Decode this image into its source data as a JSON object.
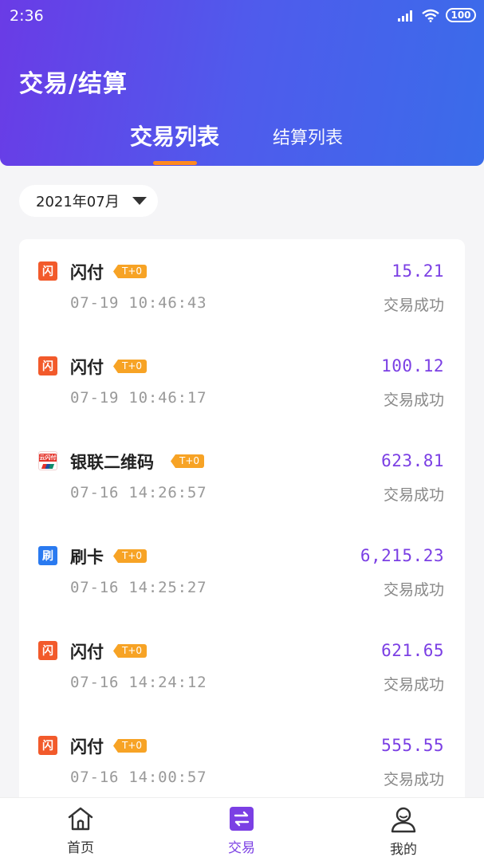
{
  "status_bar": {
    "time": "2:36",
    "battery": "100"
  },
  "header": {
    "title": "交易/结算"
  },
  "tabs": [
    {
      "label": "交易列表",
      "active": true
    },
    {
      "label": "结算列表",
      "active": false
    }
  ],
  "filter": {
    "month": "2021年07月"
  },
  "transactions": [
    {
      "icon": "flash-icon",
      "icon_char": "闪",
      "name": "闪付",
      "badge": "T+0",
      "amount": "15.21",
      "time": "07-19 10:46:43",
      "status": "交易成功"
    },
    {
      "icon": "flash-icon",
      "icon_char": "闪",
      "name": "闪付",
      "badge": "T+0",
      "amount": "100.12",
      "time": "07-19 10:46:17",
      "status": "交易成功"
    },
    {
      "icon": "unionpay-icon",
      "icon_char": "云闪付",
      "name": "银联二维码",
      "badge": "T+0",
      "amount": "623.81",
      "time": "07-16 14:26:57",
      "status": "交易成功"
    },
    {
      "icon": "card-icon",
      "icon_char": "刷",
      "name": "刷卡",
      "badge": "T+0",
      "amount": "6,215.23",
      "time": "07-16 14:25:27",
      "status": "交易成功"
    },
    {
      "icon": "flash-icon",
      "icon_char": "闪",
      "name": "闪付",
      "badge": "T+0",
      "amount": "621.65",
      "time": "07-16 14:24:12",
      "status": "交易成功"
    },
    {
      "icon": "flash-icon",
      "icon_char": "闪",
      "name": "闪付",
      "badge": "T+0",
      "amount": "555.55",
      "time": "07-16 14:00:57",
      "status": "交易成功"
    }
  ],
  "bottom_nav": [
    {
      "label": "首页",
      "icon": "home-icon",
      "active": false
    },
    {
      "label": "交易",
      "icon": "exchange-icon",
      "active": true
    },
    {
      "label": "我的",
      "icon": "profile-icon",
      "active": false
    }
  ],
  "colors": {
    "accent": "#7b3fe4",
    "badge": "#f7a325",
    "indicator": "#ff8a1e"
  }
}
